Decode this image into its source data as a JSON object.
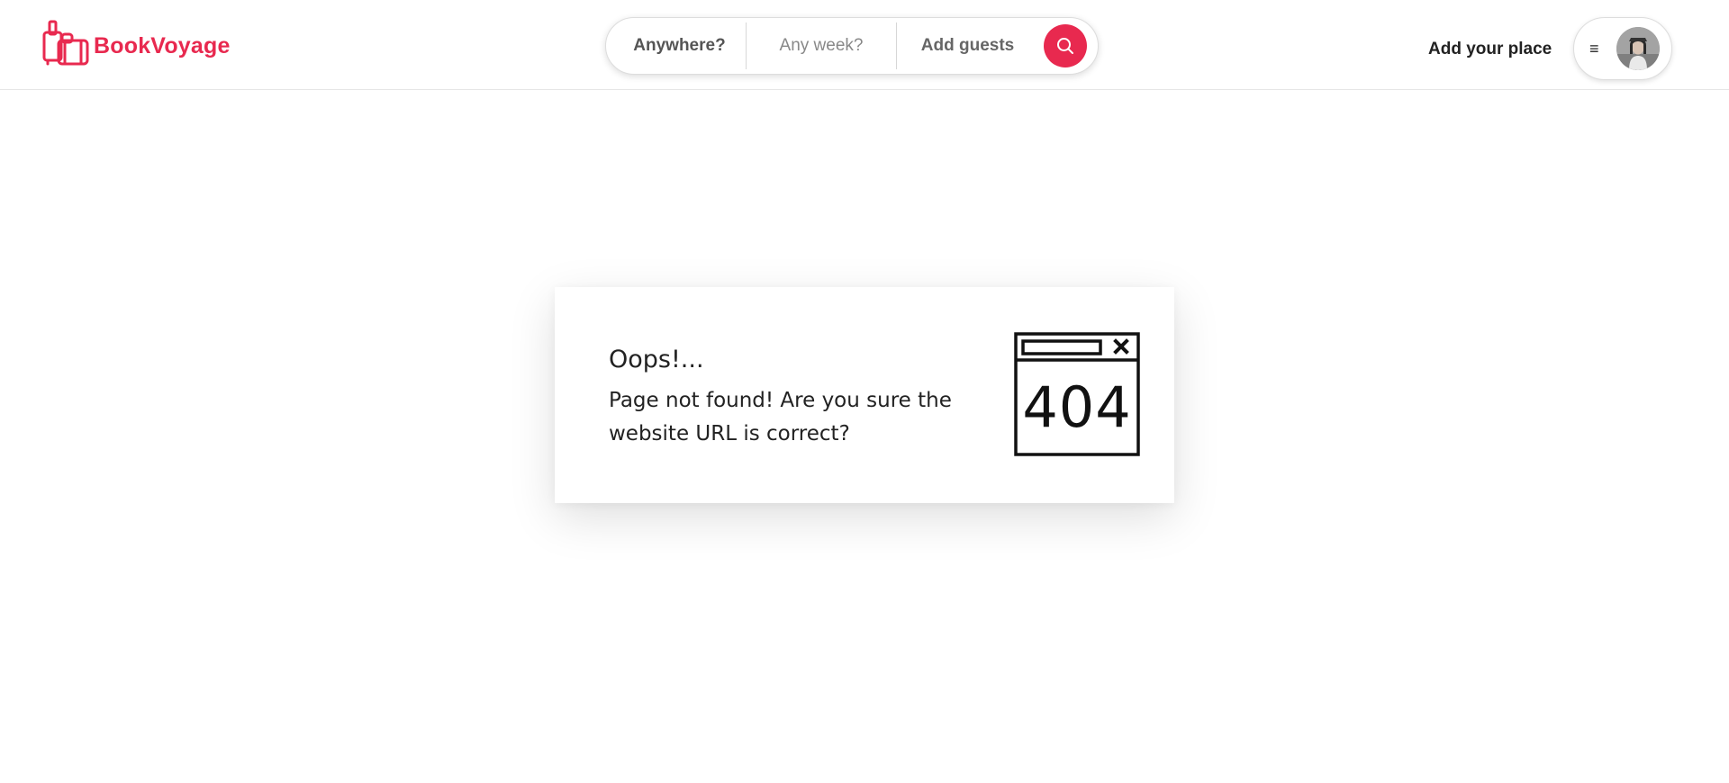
{
  "header": {
    "brand": "BookVoyage",
    "search": {
      "where_label": "Anywhere?",
      "week_label": "Any week?",
      "guests_label": "Add guests"
    },
    "add_place_label": "Add your place",
    "menu_icon": "≡"
  },
  "icons": {
    "logo": "luggage-icon",
    "search": "search-icon",
    "menu": "hamburger-menu-icon",
    "illustration": "browser-window-404-icon"
  },
  "colors": {
    "brand": "#e8294f",
    "text": "#222222"
  },
  "error_card": {
    "title": "Oops!...",
    "message": "Page not found! Are you sure the website URL is correct?",
    "illustration_text": "404"
  }
}
